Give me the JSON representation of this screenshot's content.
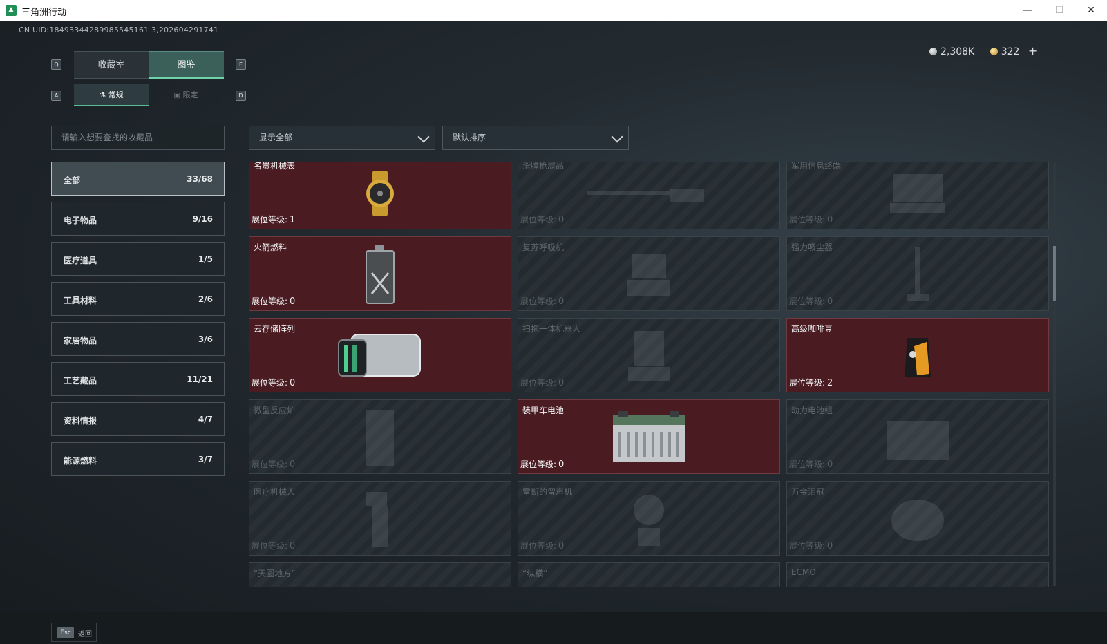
{
  "window": {
    "title": "三角洲行动",
    "min": "—",
    "max": "☐",
    "close": "✕"
  },
  "uid": "CN UID:18493344289985545161 3,202604291741",
  "currency": {
    "silver": "2,308K",
    "gold": "322",
    "plus": "+"
  },
  "tabs": {
    "collect": "收藏室",
    "atlas": "图鉴",
    "key_left": "Q",
    "key_right": "E"
  },
  "subtabs": {
    "regular": "常规",
    "limited": "限定",
    "key_left": "A",
    "key_right": "D"
  },
  "search": {
    "placeholder": "请输入想要查找的收藏品"
  },
  "filter": {
    "value": "显示全部"
  },
  "sort": {
    "value": "默认排序"
  },
  "categories": [
    {
      "label": "全部",
      "count": "33/68"
    },
    {
      "label": "电子物品",
      "count": "9/16"
    },
    {
      "label": "医疗道具",
      "count": "1/5"
    },
    {
      "label": "工具材料",
      "count": "2/6"
    },
    {
      "label": "家居物品",
      "count": "3/6"
    },
    {
      "label": "工艺藏品",
      "count": "11/21"
    },
    {
      "label": "资料情报",
      "count": "4/7"
    },
    {
      "label": "能源燃料",
      "count": "3/7"
    }
  ],
  "level_label": "展位等级:",
  "items": [
    {
      "name": "名贵机械表",
      "level": "1",
      "owned": true,
      "icon": "watch-icon"
    },
    {
      "name": "滑膛枪展品",
      "level": "0",
      "owned": false,
      "icon": "musket-icon"
    },
    {
      "name": "军用信息终端",
      "level": "0",
      "owned": false,
      "icon": "terminal-icon"
    },
    {
      "name": "火箭燃料",
      "level": "0",
      "owned": true,
      "icon": "fuel-can-icon"
    },
    {
      "name": "复苏呼吸机",
      "level": "0",
      "owned": false,
      "icon": "ventilator-icon"
    },
    {
      "name": "强力吸尘器",
      "level": "0",
      "owned": false,
      "icon": "vacuum-icon"
    },
    {
      "name": "云存储阵列",
      "level": "0",
      "owned": true,
      "icon": "storage-array-icon"
    },
    {
      "name": "扫拖一体机器人",
      "level": "0",
      "owned": false,
      "icon": "robot-vacuum-icon"
    },
    {
      "name": "高级咖啡豆",
      "level": "2",
      "owned": true,
      "icon": "coffee-bag-icon"
    },
    {
      "name": "微型反应炉",
      "level": "0",
      "owned": false,
      "icon": "reactor-icon"
    },
    {
      "name": "装甲车电池",
      "level": "0",
      "owned": true,
      "icon": "battery-icon"
    },
    {
      "name": "动力电池组",
      "level": "0",
      "owned": false,
      "icon": "battery-pack-icon"
    },
    {
      "name": "医疗机械人",
      "level": "0",
      "owned": false,
      "icon": "medical-robot-icon"
    },
    {
      "name": "雷斯的留声机",
      "level": "0",
      "owned": false,
      "icon": "gramophone-icon"
    },
    {
      "name": "万金泪冠",
      "level": "0",
      "owned": false,
      "icon": "crown-icon"
    },
    {
      "name": "“天圆地方”",
      "level": "0",
      "owned": false,
      "icon": "artifact-icon"
    },
    {
      "name": "“纵横”",
      "level": "0",
      "owned": false,
      "icon": "artifact-icon"
    },
    {
      "name": "ECMO",
      "level": "0",
      "owned": false,
      "icon": "ecmo-icon"
    }
  ],
  "footer": {
    "esc_key": "Esc",
    "esc_label": "返回"
  }
}
